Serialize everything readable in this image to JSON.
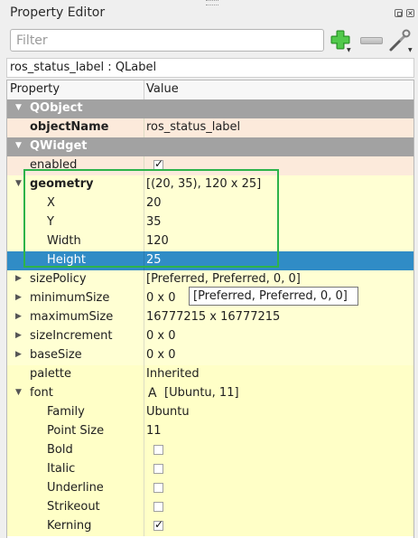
{
  "panel": {
    "title": "Property Editor",
    "float_icon": "float-window-icon",
    "close_icon": "close-icon"
  },
  "filter": {
    "placeholder": "Filter",
    "value": ""
  },
  "toolbar": {
    "add_icon": "add-dynamic-property-icon",
    "remove_icon": "remove-dynamic-property-icon",
    "config_icon": "configure-icon"
  },
  "object_label": "ros_status_label : QLabel",
  "columns": {
    "property": "Property",
    "value": "Value"
  },
  "rows": [
    {
      "kind": "group",
      "name": "QObject",
      "expander": "▼"
    },
    {
      "kind": "prop",
      "style": "peach",
      "name": "objectName",
      "bold": true,
      "value": "ros_status_label"
    },
    {
      "kind": "group",
      "name": "QWidget",
      "expander": "▼"
    },
    {
      "kind": "prop",
      "style": "peach",
      "name": "enabled",
      "checkbox": true
    },
    {
      "kind": "prop",
      "style": "yellow",
      "name": "geometry",
      "bold": true,
      "expander": "▼",
      "value": "[(20, 35), 120 x 25]"
    },
    {
      "kind": "prop",
      "style": "yellow",
      "name": "X",
      "indent": 1,
      "value": "20"
    },
    {
      "kind": "prop",
      "style": "yellow",
      "name": "Y",
      "indent": 1,
      "value": "35"
    },
    {
      "kind": "prop",
      "style": "yellow",
      "name": "Width",
      "indent": 1,
      "value": "120"
    },
    {
      "kind": "prop",
      "style": "selected",
      "name": "Height",
      "indent": 1,
      "value": "25"
    },
    {
      "kind": "prop",
      "style": "yellow",
      "name": "sizePolicy",
      "expander": "▶",
      "value": "[Preferred, Preferred, 0, 0]"
    },
    {
      "kind": "prop",
      "style": "yellow",
      "name": "minimumSize",
      "expander": "▶",
      "value": "0 x 0"
    },
    {
      "kind": "prop",
      "style": "yellow",
      "name": "maximumSize",
      "expander": "▶",
      "value": "16777215 x 16777215"
    },
    {
      "kind": "prop",
      "style": "yellow",
      "name": "sizeIncrement",
      "expander": "▶",
      "value": "0 x 0"
    },
    {
      "kind": "prop",
      "style": "yellow",
      "name": "baseSize",
      "expander": "▶",
      "value": "0 x 0"
    },
    {
      "kind": "prop",
      "style": "yellow2",
      "name": "palette",
      "value": "Inherited"
    },
    {
      "kind": "prop",
      "style": "yellow2",
      "name": "font",
      "expander": "▼",
      "value_icon": "A",
      "value": "[Ubuntu, 11]"
    },
    {
      "kind": "prop",
      "style": "yellow2",
      "name": "Family",
      "indent": 1,
      "value": "Ubuntu"
    },
    {
      "kind": "prop",
      "style": "yellow2",
      "name": "Point Size",
      "indent": 1,
      "value": "11"
    },
    {
      "kind": "prop",
      "style": "yellow2",
      "name": "Bold",
      "indent": 1,
      "checkbox": false
    },
    {
      "kind": "prop",
      "style": "yellow2",
      "name": "Italic",
      "indent": 1,
      "checkbox": false
    },
    {
      "kind": "prop",
      "style": "yellow2",
      "name": "Underline",
      "indent": 1,
      "checkbox": false
    },
    {
      "kind": "prop",
      "style": "yellow2",
      "name": "Strikeout",
      "indent": 1,
      "checkbox": false
    },
    {
      "kind": "prop",
      "style": "yellow2",
      "name": "Kerning",
      "indent": 1,
      "checkbox": true
    }
  ],
  "tooltip": "[Preferred, Preferred, 0, 0]",
  "colors": {
    "group_header": "#a2a2a2",
    "selection": "#308cc6",
    "highlight_box": "#2db34a",
    "row_peach": "#fceadb",
    "row_yellow": "#ffffd3"
  }
}
